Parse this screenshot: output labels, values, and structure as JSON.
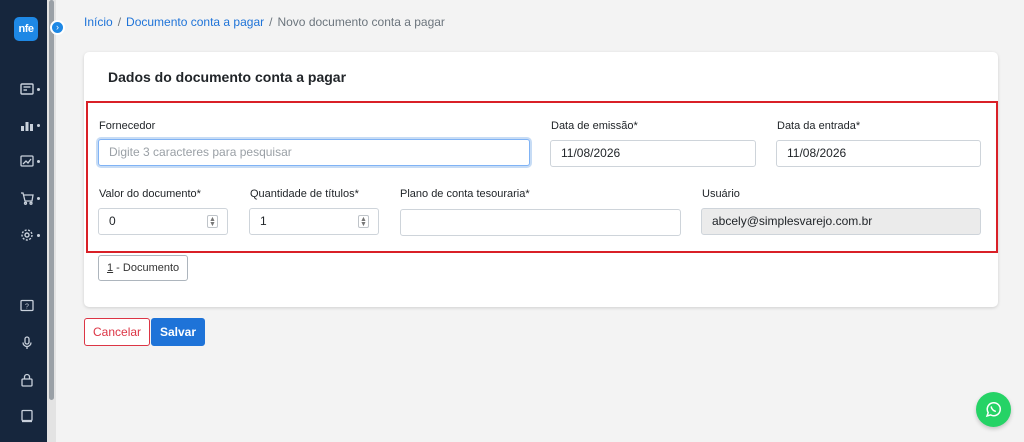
{
  "app": {
    "logo_text": "nfe"
  },
  "breadcrumb": {
    "items": [
      "Início",
      "Documento conta a pagar",
      "Novo documento conta a pagar"
    ],
    "separator": "/"
  },
  "card": {
    "title": "Dados do documento conta a pagar"
  },
  "form": {
    "fornecedor": {
      "label": "Fornecedor",
      "placeholder": "Digite 3 caracteres para pesquisar",
      "value": ""
    },
    "data_emissao": {
      "label": "Data de emissão*",
      "value": "11/08/2026"
    },
    "data_entrada": {
      "label": "Data da entrada*",
      "value": "11/08/2026"
    },
    "valor_documento": {
      "label": "Valor do documento*",
      "value": "0"
    },
    "quantidade_titulos": {
      "label": "Quantidade de títulos*",
      "value": "1"
    },
    "plano_conta": {
      "label": "Plano de conta tesouraria*",
      "value": ""
    },
    "usuario": {
      "label": "Usuário",
      "value": "abcely@simplesvarejo.com.br"
    }
  },
  "tabs": [
    {
      "number": "1",
      "label": " - Documento"
    }
  ],
  "actions": {
    "cancel_label": "Cancelar",
    "save_label": "Salvar"
  },
  "colors": {
    "accent": "#1e73d8",
    "sidebar": "#16263d",
    "highlight": "#d92027",
    "danger": "#dc3545",
    "whatsapp": "#25d366"
  },
  "icons": [
    "dashboard-icon",
    "chart-icon",
    "report-icon",
    "cart-icon",
    "settings-icon",
    "help-icon",
    "microphone-icon",
    "lock-icon",
    "book-icon",
    "whatsapp-icon"
  ]
}
